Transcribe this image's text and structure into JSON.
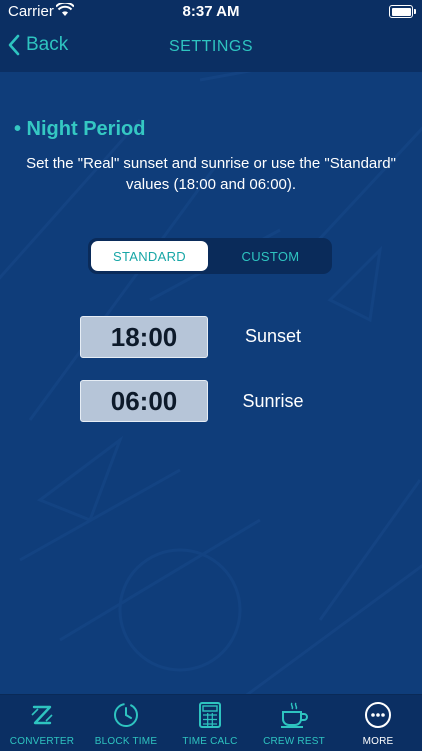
{
  "status_bar": {
    "carrier": "Carrier",
    "time": "8:37 AM"
  },
  "nav": {
    "back_label": "Back",
    "title": "SETTINGS"
  },
  "section": {
    "title": "• Night Period",
    "description": "Set the \"Real\" sunset and sunrise or use the \"Standard\" values (18:00 and 06:00)."
  },
  "segmented": {
    "options": [
      "STANDARD",
      "CUSTOM"
    ],
    "selected": "STANDARD"
  },
  "times": {
    "sunset": {
      "value": "18:00",
      "label": "Sunset"
    },
    "sunrise": {
      "value": "06:00",
      "label": "Sunrise"
    }
  },
  "tab_bar": {
    "active": "MORE",
    "items": [
      {
        "label": "CONVERTER",
        "icon": "converter-icon"
      },
      {
        "label": "BLOCK TIME",
        "icon": "clock-icon"
      },
      {
        "label": "TIME CALC",
        "icon": "calculator-icon"
      },
      {
        "label": "CREW REST",
        "icon": "coffee-cup-icon"
      },
      {
        "label": "MORE",
        "icon": "more-icon"
      }
    ]
  },
  "colors": {
    "accent": "#2ec4c0",
    "background": "#0f3d7a",
    "bar": "#0b2f63",
    "time_box": "#b6c5d8"
  }
}
